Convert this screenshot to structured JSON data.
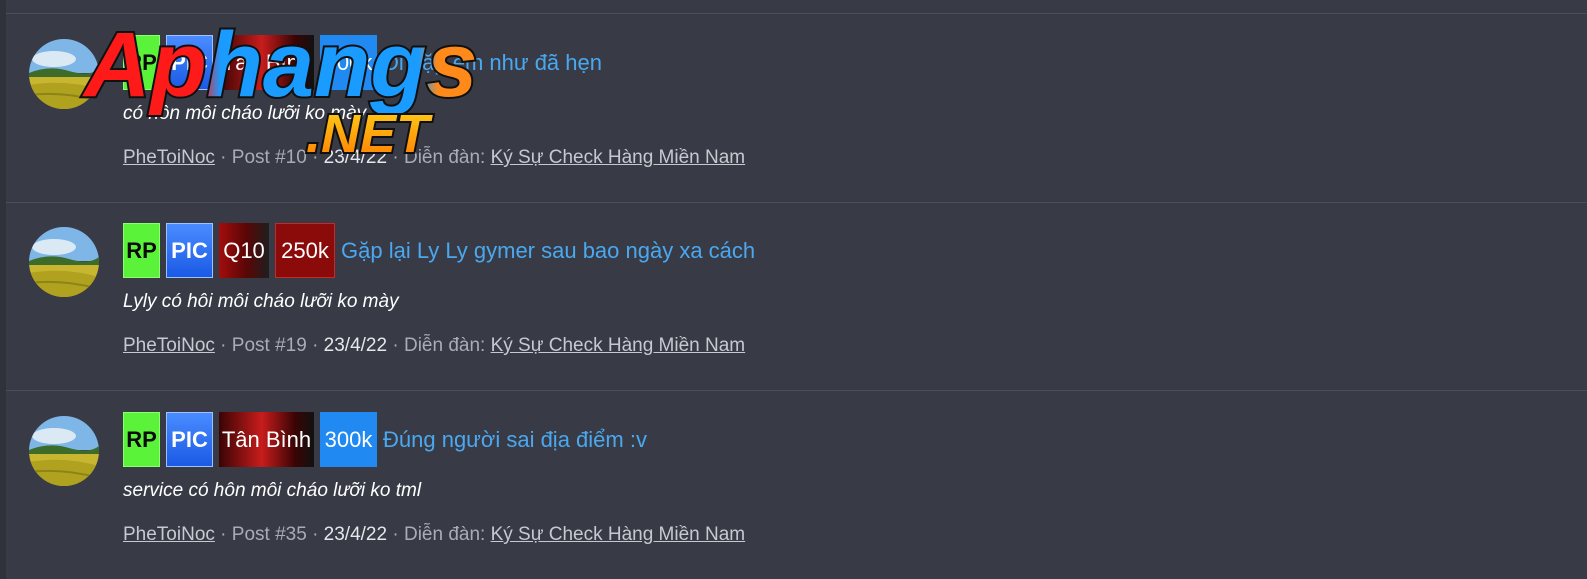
{
  "results": [
    {
      "labels": [
        {
          "text": "RP",
          "style": "rp"
        },
        {
          "text": "PIC",
          "style": "pic"
        },
        {
          "text": "Tân Bình",
          "style": "tanbinh"
        },
        {
          "text": "300k",
          "style": "price-blue"
        }
      ],
      "title": "Đi gặp em như đã hẹn",
      "snippet": "có hôn môi cháo lưỡi ko mày",
      "author": "PheToiNoc",
      "post": "Post #10",
      "date": "23/4/22",
      "forum_prefix": "Diễn đàn:",
      "forum": "Ký Sự Check Hàng Miền Nam"
    },
    {
      "labels": [
        {
          "text": "RP",
          "style": "rp"
        },
        {
          "text": "PIC",
          "style": "pic"
        },
        {
          "text": "Q10",
          "style": "q10"
        },
        {
          "text": "250k",
          "style": "price-red"
        }
      ],
      "title": "Gặp lại Ly Ly gymer sau bao ngày xa cách",
      "snippet": "Lyly có hôi môi cháo lưỡi ko mày",
      "author": "PheToiNoc",
      "post": "Post #19",
      "date": "23/4/22",
      "forum_prefix": "Diễn đàn:",
      "forum": "Ký Sự Check Hàng Miền Nam"
    },
    {
      "labels": [
        {
          "text": "RP",
          "style": "rp"
        },
        {
          "text": "PIC",
          "style": "pic"
        },
        {
          "text": "Tân Bình",
          "style": "tanbinh"
        },
        {
          "text": "300k",
          "style": "price-blue"
        }
      ],
      "title": "Đúng người sai địa điểm :v",
      "snippet": "service có hôn môi cháo lưỡi ko tml",
      "author": "PheToiNoc",
      "post": "Post #35",
      "date": "23/4/22",
      "forum_prefix": "Diễn đàn:",
      "forum": "Ký Sự Check Hàng Miền Nam"
    }
  ],
  "watermark": {
    "line1": "Aphangs",
    "line2": ".NET"
  },
  "colors": {
    "background": "#383b45",
    "link": "#4aa8f0",
    "meta": "#a8acb4",
    "rp_label": "#5bf23a",
    "pic_label": "#2a6ef0",
    "price_blue": "#2189f2",
    "price_red": "#8b0a0a"
  }
}
